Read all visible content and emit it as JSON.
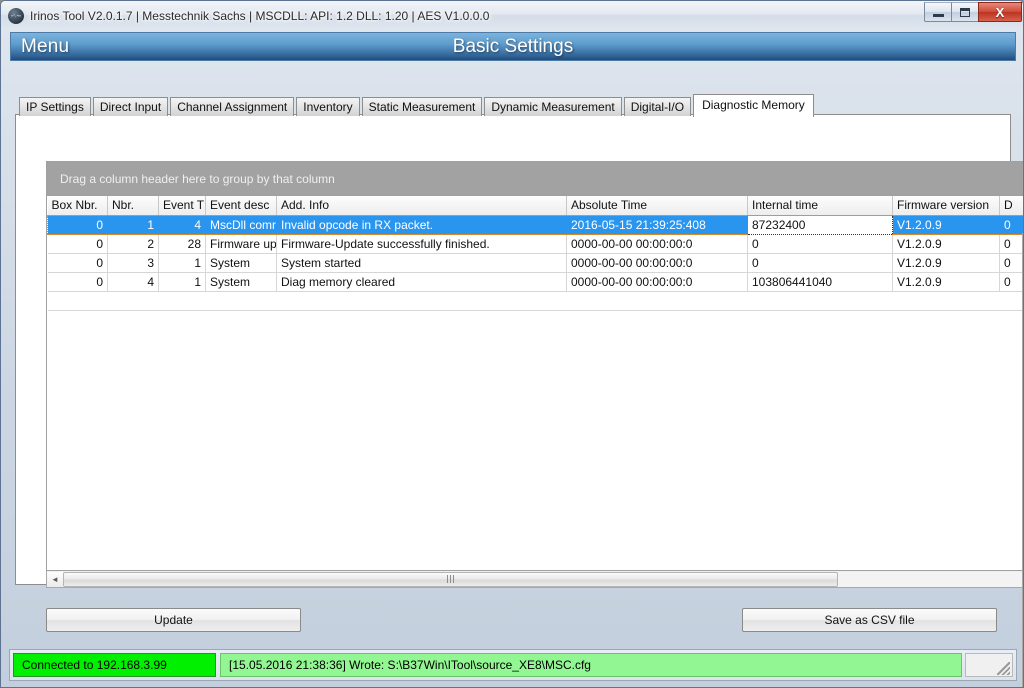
{
  "window": {
    "title": "Irinos Tool V2.0.1.7 | Messtechnik Sachs | MSCDLL: API: 1.2 DLL: 1.20 | AES V1.0.0.0",
    "icon": "app-icon",
    "controls": {
      "minimize": "–",
      "maximize": "❑",
      "close": "X"
    }
  },
  "header": {
    "menu_label": "Menu",
    "page_title": "Basic Settings",
    "accent_color": "#2e5f92"
  },
  "tabs": [
    {
      "label": "IP Settings",
      "active": false
    },
    {
      "label": "Direct Input",
      "active": false
    },
    {
      "label": "Channel Assignment",
      "active": false
    },
    {
      "label": "Inventory",
      "active": false
    },
    {
      "label": "Static Measurement",
      "active": false
    },
    {
      "label": "Dynamic Measurement",
      "active": false
    },
    {
      "label": "Digital-I/O",
      "active": false
    },
    {
      "label": "Diagnostic Memory",
      "active": true
    }
  ],
  "grid": {
    "group_panel_text": "Drag a column header here to group by that column",
    "columns": [
      "Box Nbr.",
      "Nbr.",
      "Event T",
      "Event desc",
      "Add. Info",
      "Absolute Time",
      "Internal time",
      "Firmware version",
      "D"
    ],
    "rows": [
      {
        "selected": true,
        "cells": [
          "0",
          "1",
          "4",
          "MscDll comr",
          "Invalid opcode in RX packet.",
          "2016-05-15 21:39:25:408",
          "87232400",
          "V1.2.0.9",
          "0"
        ]
      },
      {
        "selected": false,
        "cells": [
          "0",
          "2",
          "28",
          "Firmware uр",
          "Firmware-Update successfully finished.",
          "0000-00-00 00:00:00:0",
          "0",
          "V1.2.0.9",
          "0"
        ]
      },
      {
        "selected": false,
        "cells": [
          "0",
          "3",
          "1",
          "System",
          "System started",
          "0000-00-00 00:00:00:0",
          "0",
          "V1.2.0.9",
          "0"
        ]
      },
      {
        "selected": false,
        "cells": [
          "0",
          "4",
          "1",
          "System",
          "Diag memory cleared",
          "0000-00-00 00:00:00:0",
          "103806441040",
          "V1.2.0.9",
          "0"
        ]
      }
    ],
    "selection_color": "#2a95ef",
    "focused_cell_index": 6,
    "hscroll": {
      "left_arrow": "◄",
      "right_arrow": "►"
    }
  },
  "buttons": {
    "update": "Update",
    "save_csv": "Save as CSV file"
  },
  "status": {
    "connection": "Connected to 192.168.3.99",
    "connection_color": "#00f000",
    "message": "[15.05.2016 21:38:36] Wrote: S:\\B37Win\\ITool\\source_XE8\\MSC.cfg",
    "message_color": "#92f792"
  }
}
